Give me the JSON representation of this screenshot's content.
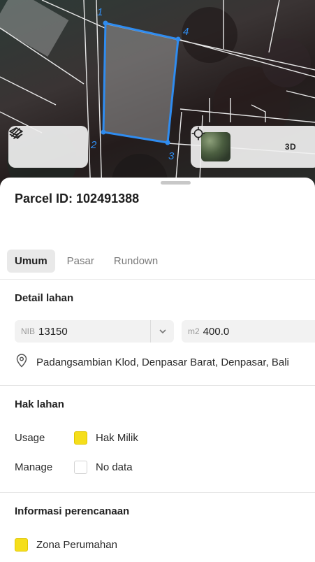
{
  "map": {
    "vertex_labels": [
      "1",
      "2",
      "3",
      "4"
    ],
    "parcel_outline_color": "#2f8cf0",
    "layers_icon": "layers-icon",
    "measure_icon": "measure-tool-icon",
    "locate_icon": "crosshair-locate-icon",
    "satellite_thumb": "satellite-basemap-thumbnail",
    "btn_3d": "3D"
  },
  "sheet": {
    "parcel_title": "Parcel ID: 102491388",
    "tabs": [
      {
        "label": "Umum",
        "active": true
      },
      {
        "label": "Pasar",
        "active": false
      },
      {
        "label": "Rundown",
        "active": false
      }
    ]
  },
  "detail_lahan": {
    "title": "Detail lahan",
    "nib_prefix": "NIB",
    "nib_value": "13150",
    "area_prefix": "m2",
    "area_value": "400.0",
    "address_icon": "location-pin-icon",
    "address": "Padangsambian Klod, Denpasar Barat, Denpasar, Bali"
  },
  "hak_lahan": {
    "title": "Hak lahan",
    "usage_label": "Usage",
    "usage_value": "Hak Milik",
    "usage_color": "#f5de1b",
    "manage_label": "Manage",
    "manage_value": "No data",
    "manage_color": "#ffffff"
  },
  "informasi_perencanaan": {
    "title": "Informasi perencanaan",
    "zone_value": "Zona Perumahan",
    "zone_color": "#f5de1b"
  }
}
